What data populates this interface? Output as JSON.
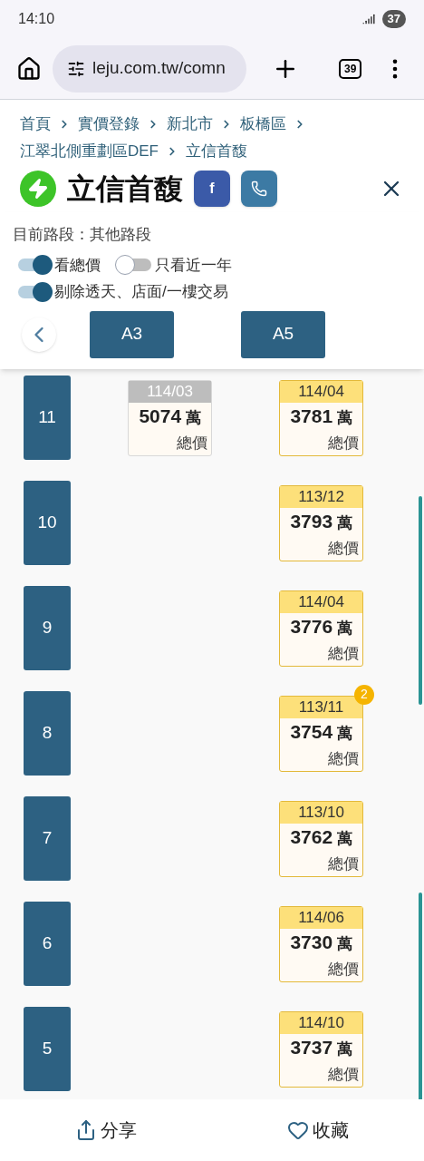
{
  "status_bar": {
    "time": "14:10",
    "battery": "37"
  },
  "browser": {
    "url": "leju.com.tw/comn",
    "tab_count": "39"
  },
  "breadcrumb": [
    "首頁",
    "實價登錄",
    "新北市",
    "板橋區",
    "江翠北側重劃區DEF",
    "立信首馥"
  ],
  "title": "立信首馥",
  "facebook_label": "f",
  "segment": "目前路段：其他路段",
  "toggles": [
    {
      "label": "看總價",
      "on": true
    },
    {
      "label": "只看近一年",
      "on": false
    },
    {
      "label": "剔除透天、店面/一樓交易",
      "on": true
    }
  ],
  "columns": [
    "A3",
    "A5"
  ],
  "rows": [
    {
      "floor": "11",
      "cells": [
        {
          "date": "114/03",
          "price": "5074",
          "unit": "萬",
          "caption": "總價",
          "highlighted": false
        },
        {
          "date": "114/04",
          "price": "3781",
          "unit": "萬",
          "caption": "總價",
          "highlighted": true
        }
      ]
    },
    {
      "floor": "10",
      "cells": [
        null,
        {
          "date": "113/12",
          "price": "3793",
          "unit": "萬",
          "caption": "總價",
          "highlighted": true
        }
      ]
    },
    {
      "floor": "9",
      "cells": [
        null,
        {
          "date": "114/04",
          "price": "3776",
          "unit": "萬",
          "caption": "總價",
          "highlighted": true
        }
      ]
    },
    {
      "floor": "8",
      "cells": [
        null,
        {
          "date": "113/11",
          "price": "3754",
          "unit": "萬",
          "caption": "總價",
          "highlighted": true,
          "count": "2"
        }
      ]
    },
    {
      "floor": "7",
      "cells": [
        null,
        {
          "date": "113/10",
          "price": "3762",
          "unit": "萬",
          "caption": "總價",
          "highlighted": true
        }
      ]
    },
    {
      "floor": "6",
      "cells": [
        null,
        {
          "date": "114/06",
          "price": "3730",
          "unit": "萬",
          "caption": "總價",
          "highlighted": true
        }
      ]
    },
    {
      "floor": "5",
      "cells": [
        null,
        {
          "date": "114/10",
          "price": "3737",
          "unit": "萬",
          "caption": "總價",
          "highlighted": true
        }
      ]
    }
  ],
  "footer": [
    "分享",
    "收藏"
  ]
}
